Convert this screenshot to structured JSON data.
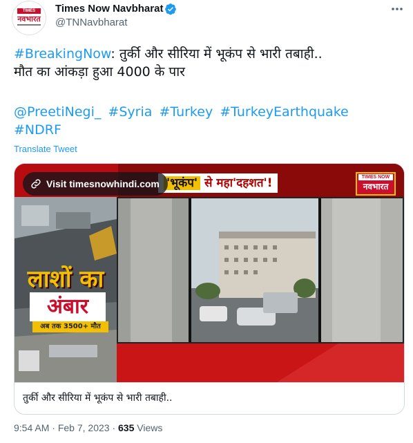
{
  "author": {
    "name": "Times Now Navbharat",
    "handle": "@TNNavbharat",
    "avatar": {
      "line1": "TIMES NOW",
      "line2": "नवभारत"
    }
  },
  "tweet": {
    "lead_tag": "#BreakingNow",
    "line1_rest": ": तुर्की और सीरिया में भूकंप से भारी तबाही..",
    "line2": "मौत का आंकड़ा हुआ 4000 के पार",
    "mention": "@PreetiNegi_",
    "hashtags": [
      "#Syria",
      "#Turkey",
      "#TurkeyEarthquake",
      "#NDRF"
    ],
    "translate_label": "Translate Tweet"
  },
  "card": {
    "visit_label": "Visit timesnowhindi.com",
    "title": "तुर्की और सीरिया में भूकंप से भारी तबाही..",
    "image_text": {
      "headline_a": "'भूकंप'",
      "headline_b": "से महा'दहशत'!",
      "headline_pre": "",
      "logo_top": "TIMES NOW",
      "logo_bottom": "नवभारत",
      "side_line1": "लाशों का",
      "side_line2": "अंबार",
      "side_line3": "अब तक 3500+ मौत"
    }
  },
  "meta": {
    "time": "9:54 AM",
    "date": "Feb 7, 2023",
    "views_count": "635",
    "views_label": "Views"
  },
  "colors": {
    "link": "#1d9bf0",
    "text": "#0f1419",
    "muted": "#536471",
    "brand_red": "#c8102e"
  }
}
